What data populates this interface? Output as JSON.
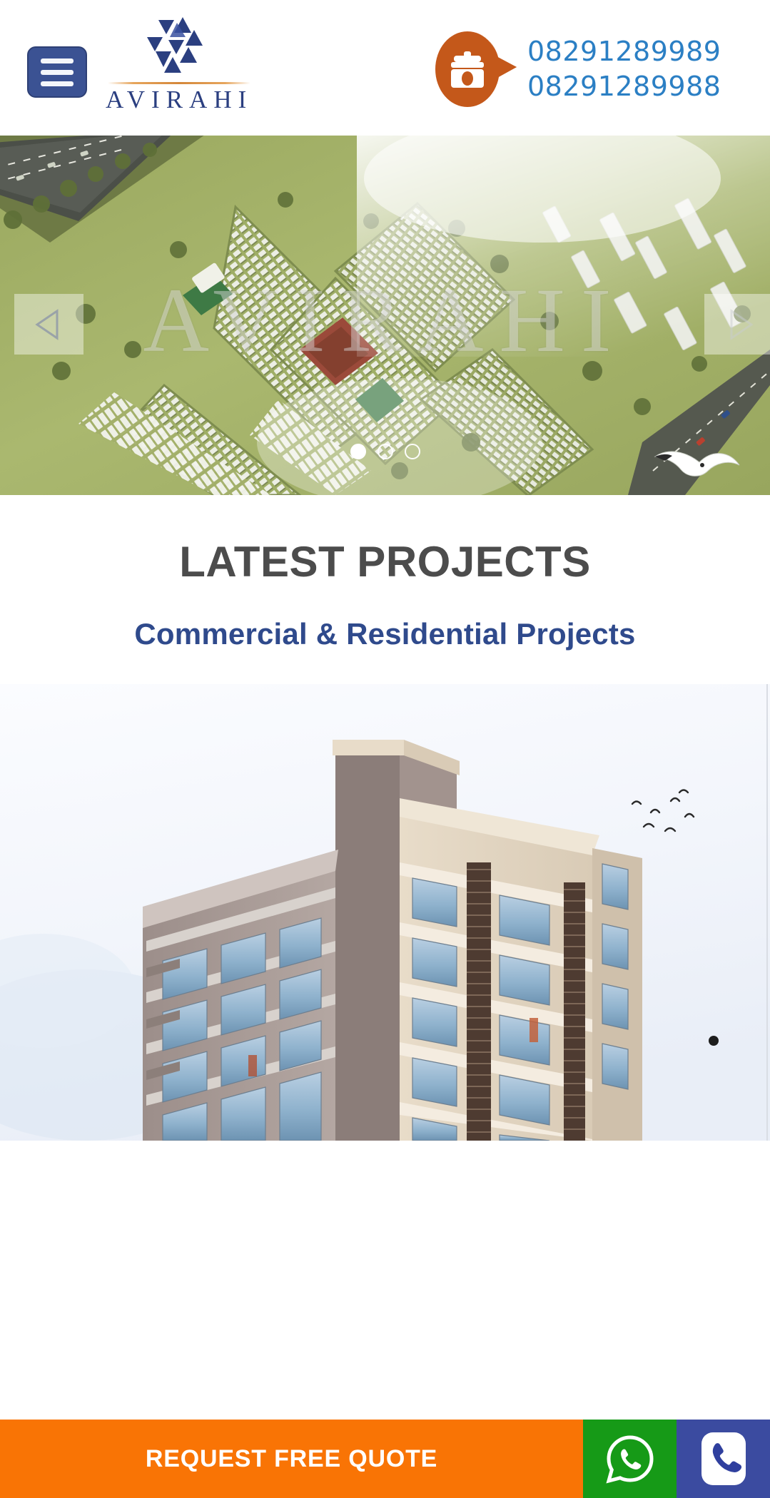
{
  "header": {
    "menu_button_label": "Menu",
    "logo_text": "AVIRAHI",
    "phone_icon": "telephone-icon",
    "phones": [
      {
        "number": "08291289989"
      },
      {
        "number": "08291289988"
      }
    ],
    "phone_color": "#2b7fc4",
    "menu_button_color": "#3b5293",
    "logo_color": "#2b3f80",
    "logo_rule_color": "#d4873a"
  },
  "hero": {
    "watermark": "AVIRAHI",
    "prev_arrow_label": "Previous slide",
    "next_arrow_label": "Next slide",
    "slides": [
      {
        "alt": "Aerial view of Avirahi township master plan"
      },
      {
        "alt": "Slide 2"
      },
      {
        "alt": "Slide 3"
      }
    ],
    "active_slide_index": 0,
    "dot_count": 3
  },
  "projects_section": {
    "title": "LATEST PROJECTS",
    "subtitle": "Commercial & Residential Projects",
    "title_color": "#4c4c4c",
    "subtitle_color": "#2f4a8c",
    "slide_alt": "Residential high-rise apartment building exterior render"
  },
  "bottom_bar": {
    "quote_label": "REQUEST FREE QUOTE",
    "quote_color": "#f97405",
    "whatsapp_icon": "whatsapp-icon",
    "whatsapp_color": "#169a17",
    "call_icon": "phone-icon",
    "call_color": "#3b4ba0"
  }
}
